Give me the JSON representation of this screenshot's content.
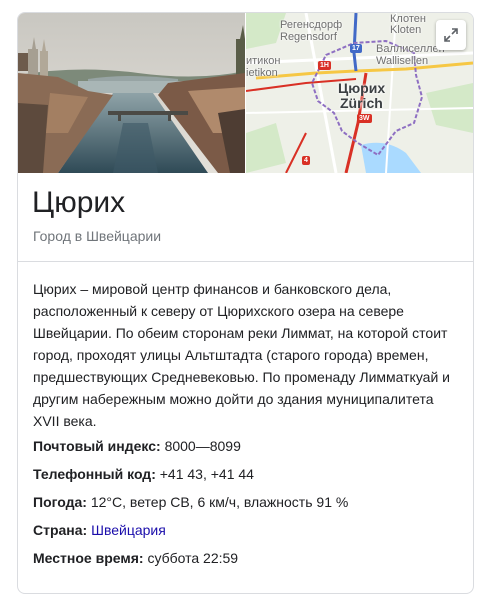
{
  "map": {
    "labels": {
      "regensdorf_ru": "Регенсдорф",
      "regensdorf": "Regensdorf",
      "kloten_ru": "Клотен",
      "kloten": "Kloten",
      "wallisellen_ru": "Валлиселлен",
      "wallisellen": "Wallisellen",
      "dietikon_ru": "итикон",
      "dietikon": "ietikon",
      "city_ru": "Цюрих",
      "city": "Zürich"
    },
    "shields": {
      "a1": "17",
      "b1": "1H",
      "c1": "3W",
      "d1": "4"
    },
    "colors": {
      "boundary": "#8e6fc2",
      "route_red": "#d93025",
      "route_blue": "#4169c7",
      "lake": "#aadaff",
      "park": "#d4e9c8"
    }
  },
  "expand_icon": "expand-arrows-icon",
  "header": {
    "title": "Цюрих",
    "subtitle": "Город в Швейцарии"
  },
  "description": "Цюрих – мировой центр финансов и банковского дела, расположенный к северу от Цюрихского озера на севере Швейцарии. По обеим сторонам реки Лиммат, на которой стоит город, проходят улицы Альтштадта (старого города) времен, предшествующих Средневековью. По променаду Лимматкуай и другим набережным можно дойти до здания муниципалитета XVII века.",
  "facts": [
    {
      "key": "Почтовый индекс:",
      "value": "8000—8099"
    },
    {
      "key": "Телефонный код:",
      "value": "+41 43, +41 44"
    },
    {
      "key": "Погода:",
      "value": "12°C, ветер СВ, 6 км/ч, влажность 91 %"
    },
    {
      "key": "Страна:",
      "value": "Швейцария"
    },
    {
      "key": "Местное время:",
      "value": "суббота 22:59"
    }
  ],
  "colors": {
    "link": "#1a0dab",
    "muted": "#70757a",
    "border": "#dadce0"
  }
}
